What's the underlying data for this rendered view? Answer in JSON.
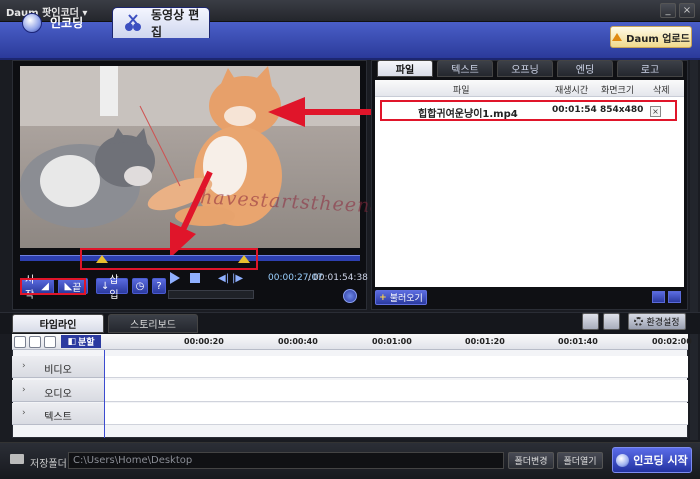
{
  "window": {
    "title": "Daum 팟인코더",
    "menu_arrow": "▾",
    "min": "_",
    "close": "×"
  },
  "top_tabs": {
    "encoding": "인코딩",
    "edit": "동영상 편집"
  },
  "daum_upload": "Daum 업로드",
  "player": {
    "current_time": "00:00:27:07",
    "separator": "/",
    "total_time": "00:01:54:38",
    "start_label": "시작",
    "end_label": "끝",
    "insert_label": "삽입",
    "help": "?",
    "trim_start_fraction": 0.24,
    "trim_end_fraction": 0.66
  },
  "file_tabs": [
    "파일",
    "텍스트",
    "오프닝",
    "엔딩",
    "로고"
  ],
  "file_table": {
    "columns": [
      "파일",
      "재생시간",
      "화면크기",
      "삭제"
    ],
    "rows": [
      {
        "name": "힙합귀여운냥이1.mp4",
        "duration": "00:01:54",
        "size": "854x480",
        "delete": "×"
      }
    ]
  },
  "import_label": "불러오기",
  "watermark": "havestartstheend.tistory",
  "timeline": {
    "tabs": [
      "타임라인",
      "스토리보드"
    ],
    "settings_label": "환경설정",
    "split_label": "분할",
    "ticks": [
      "00:00:20",
      "00:00:40",
      "00:01:00",
      "00:01:20",
      "00:01:40",
      "00:02:00"
    ],
    "tracks": [
      "비디오",
      "오디오",
      "텍스트"
    ]
  },
  "bottom": {
    "folder_label": "저장폴더",
    "path": "C:\\Users\\Home\\Desktop",
    "change_folder": "폴더변경",
    "open_folder": "폴더열기",
    "encode_start": "인코딩 시작"
  },
  "colors": {
    "accent": "#2b3aa0",
    "highlight": "#e0152a",
    "marker": "#e8c030"
  }
}
